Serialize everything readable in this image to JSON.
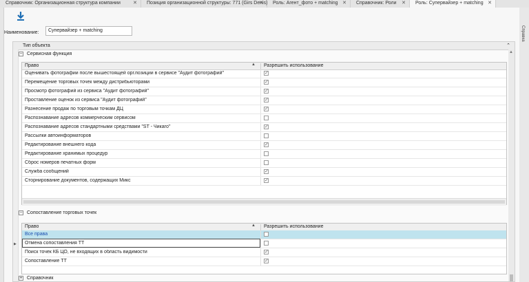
{
  "tabs": [
    {
      "label": "Справочник: Организационная структура компании",
      "close": "✕"
    },
    {
      "label": "Позиция организационной структуры: 771 (Girs Denis)",
      "close": "✕"
    },
    {
      "label": "Роль: Агент_фото + matching",
      "close": "✕"
    },
    {
      "label": "Справочник: Роли",
      "close": "✕"
    },
    {
      "label": "Роль: Супервайзер + matching",
      "close": "✕"
    }
  ],
  "right_panel": {
    "label": "Справка"
  },
  "form": {
    "name_label": "Наименование:",
    "name_value": "Супервайзер + matching",
    "grid_header": "Тип объекта"
  },
  "groups": {
    "service": {
      "title": "Сервисная функция",
      "expander": "−",
      "col_right": "Право",
      "col_allow": "Разрешить использование",
      "rows": [
        {
          "name": "Оценивать фотографии после вышестоящей орг.позиции в сервисе \"Аудит фотографий\"",
          "checked": true
        },
        {
          "name": "Перемещение торговых точек между дистрибьюторами",
          "checked": true
        },
        {
          "name": "Просмотр фотографий из сервиса \"Аудит фотографий\"",
          "checked": true
        },
        {
          "name": "Проставление оценок из сервиса \"Аудит фотографий\"",
          "checked": true
        },
        {
          "name": "Разнесение продаж по торговым точкам ДЦ",
          "checked": true
        },
        {
          "name": "Распознавание адресов коммерческим сервисом",
          "checked": false
        },
        {
          "name": "Распознавание адресов стандартными средствами \"ST - Чикаго\"",
          "checked": true
        },
        {
          "name": "Рассылки автоинформаторов",
          "checked": false
        },
        {
          "name": "Редактирование внешнего кода",
          "checked": true
        },
        {
          "name": "Редактирование хранимых процедур",
          "checked": false
        },
        {
          "name": "Сброс номеров печатных форм",
          "checked": false
        },
        {
          "name": "Служба сообщений",
          "checked": true
        },
        {
          "name": "Сторнирование документов, содержащих Микс",
          "checked": true
        }
      ]
    },
    "matching": {
      "title": "Сопоставление торговых точек",
      "expander": "−",
      "col_right": "Право",
      "col_allow": "Разрешить использование",
      "rows": [
        {
          "name": "Все права",
          "checked": false
        },
        {
          "name": "Отмена сопоставления ТТ",
          "checked": false
        },
        {
          "name": "Поиск точек КБ ЦО, не входящих в область видимости",
          "checked": true
        },
        {
          "name": "Сопоставление ТТ",
          "checked": true
        }
      ]
    },
    "reference": {
      "title": "Справочник",
      "expander": "+"
    }
  },
  "glyphs": {
    "check": "✓",
    "sort": "▲",
    "chevron": "⌃",
    "up": "▲",
    "row_marker": "▶"
  },
  "colors": {
    "selected_row": "#bfe3ee",
    "selected_text": "#1a4fb0",
    "download_icon": "#1f6fb5"
  }
}
